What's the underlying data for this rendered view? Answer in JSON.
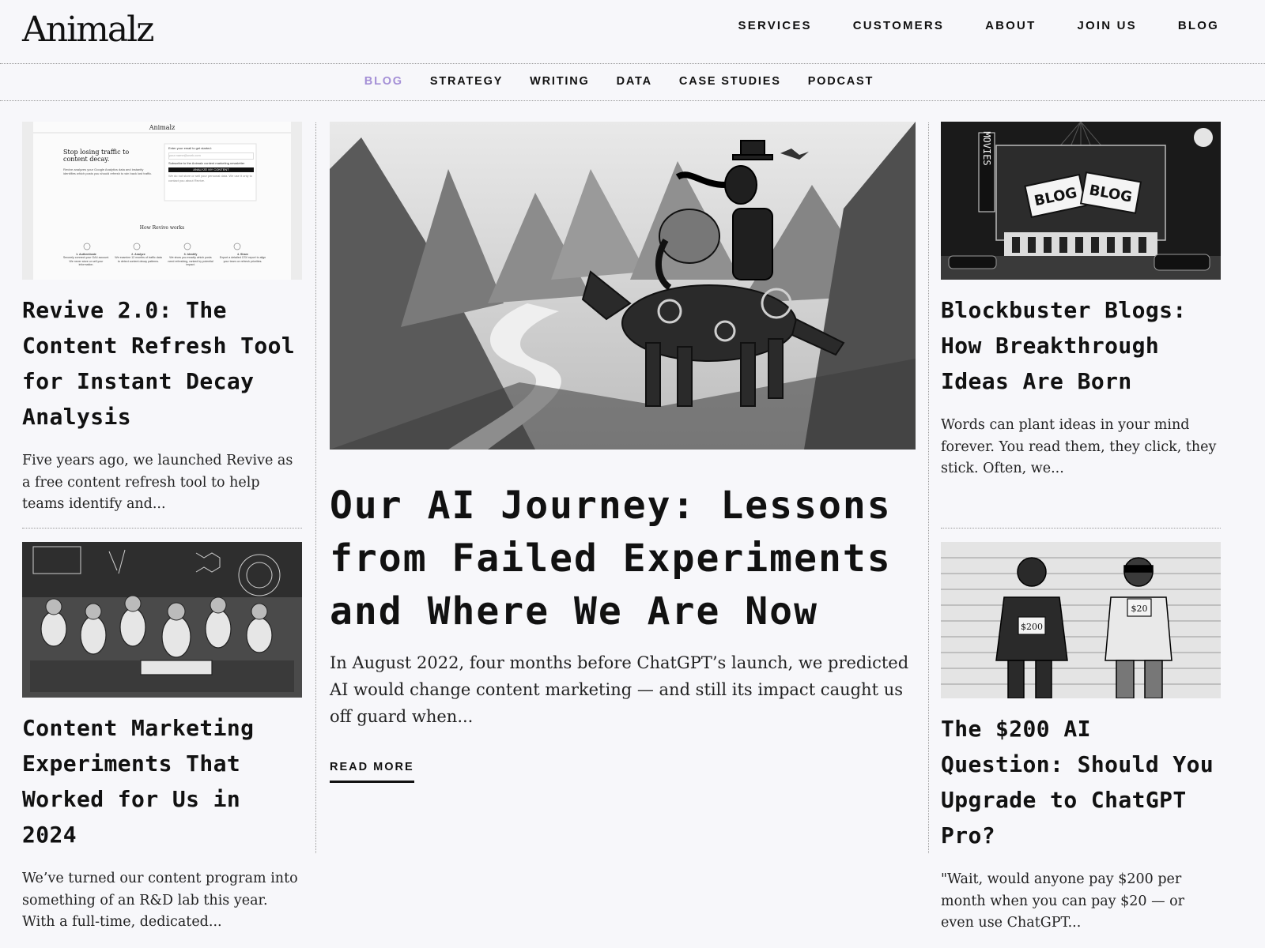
{
  "brand": {
    "logo_text": "Animalz"
  },
  "main_nav": [
    "SERVICES",
    "CUSTOMERS",
    "ABOUT",
    "JOIN US",
    "BLOG"
  ],
  "sub_nav": {
    "items": [
      "BLOG",
      "STRATEGY",
      "WRITING",
      "DATA",
      "CASE STUDIES",
      "PODCAST"
    ],
    "active": "BLOG",
    "active_color": "#a48fd6"
  },
  "thumb_revive": {
    "logo": "Animalz",
    "headline": "Stop losing traffic to content decay.",
    "body": "Revive analyzes your Google Analytics data and instantly identifies which posts you should refresh to win back lost traffic.",
    "form_label": "Enter your email to get started:",
    "form_placeholder": "your.name@work.com",
    "form_checkbox": "Subscribe to the Animalz content marketing newsletter",
    "form_button": "ANALYZE MY CONTENT",
    "form_note": "We do not store or sell your personal data. We use it only to contact you about Revive.",
    "how_title": "How Revive works",
    "steps": [
      {
        "label": "1. Authenticate",
        "text": "Securely connect your GA4 account. We never store or sell your information."
      },
      {
        "label": "2. Analyze",
        "text": "We examine 12 months of traffic data to detect content decay patterns."
      },
      {
        "label": "3. Identify",
        "text": "We show you exactly which posts need refreshing, ranked by potential impact."
      },
      {
        "label": "4. Share",
        "text": "Export a detailed CSV report to align your team on refresh priorities."
      }
    ]
  },
  "thumb_blockbuster": {
    "sign_vertical": "MOVIES",
    "marquee_left": "BLOG",
    "marquee_right": "BLOG"
  },
  "thumb_pro": {
    "left_tag": "$200",
    "right_tag": "$20"
  },
  "posts": {
    "revive": {
      "title": "Revive 2.0: The Content Refresh Tool for Instant Decay Analysis",
      "excerpt": "Five years ago, we launched Revive as a free content refresh tool to help teams identify and..."
    },
    "experiments": {
      "title": "Content Marketing Experiments That Worked for Us in 2024",
      "excerpt": "We’ve turned our content program into something of an R&D lab this year. With a full-time, dedicated..."
    },
    "ai_journey": {
      "title": "Our AI Journey: Lessons from Failed Experiments and Where We Are Now",
      "excerpt": "In August 2022, four months before ChatGPT’s launch, we predicted AI would change content marketing — and still its impact caught us off guard when...",
      "read_more": "READ MORE"
    },
    "blockbuster": {
      "title": "Blockbuster Blogs: How Breakthrough Ideas Are Born",
      "excerpt": "Words can plant ideas in your mind forever. You read them, they click, they stick. Often, we..."
    },
    "chatgpt_pro": {
      "title": "The $200 AI Question: Should You Upgrade to ChatGPT Pro?",
      "excerpt": "\"Wait, would anyone pay $200 per month when you can pay $20 — or even use ChatGPT..."
    }
  }
}
